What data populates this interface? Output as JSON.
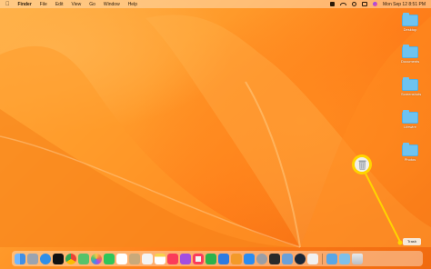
{
  "menubar": {
    "app_name": "Finder",
    "menus": [
      "File",
      "Edit",
      "View",
      "Go",
      "Window",
      "Help"
    ],
    "clock": "Mon Sep 12  8:51 PM"
  },
  "desktop": {
    "folders": [
      {
        "label": "Desktop"
      },
      {
        "label": "Documents"
      },
      {
        "label": "Screenshots"
      },
      {
        "label": "Lifewire"
      },
      {
        "label": "Photos"
      }
    ]
  },
  "dock": {
    "icons": [
      "finder-icon",
      "launchpad-icon",
      "safari-icon",
      "appletv-icon",
      "chrome-icon",
      "maps-icon",
      "photos-icon",
      "facetime-icon",
      "calendar-icon",
      "contacts-icon",
      "reminders-icon",
      "notes-icon",
      "music-icon",
      "podcasts-icon",
      "news-icon",
      "numbers-icon",
      "keynote-icon",
      "pages-icon",
      "appstore-icon",
      "settings-icon",
      "terminal-icon",
      "preview-icon",
      "steam-icon",
      "textedit-icon",
      "downloads-icon",
      "screenshots-icon",
      "trash-icon"
    ],
    "colors": [
      "#3f8fe6",
      "#9aa3b0",
      "#2f8fe8",
      "#111111",
      "#e9e9e9",
      "#57c26a",
      "#f7c94a",
      "#2fc55a",
      "#ffffff",
      "#c9a97a",
      "#f3f3f3",
      "#f7d24d",
      "#fa3c5a",
      "#a34ee0",
      "#f3f3f3",
      "#2bb24c",
      "#2d7be0",
      "#f39a2a",
      "#2b8cf0",
      "#9a9ea6",
      "#2a2a2a",
      "#6aa0d8",
      "#1b2838",
      "#f1f1f1",
      "#58a6e6",
      "#7ec0ea",
      "#cfd3d8"
    ]
  },
  "tooltip": {
    "text": "Trash"
  },
  "accent_color": "#ffd400"
}
